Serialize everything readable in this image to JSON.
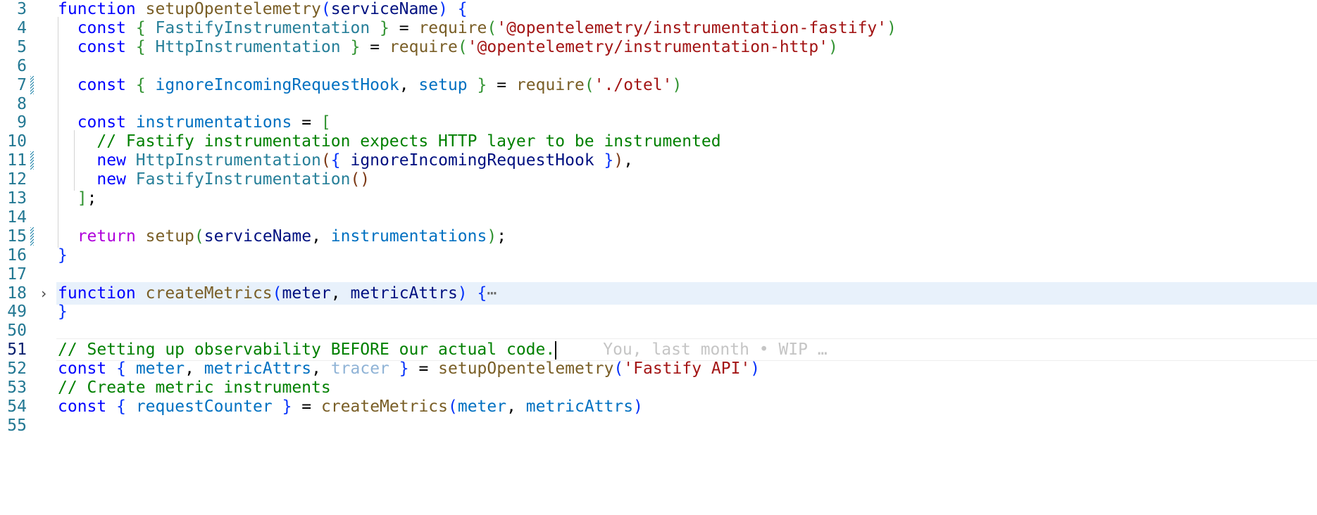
{
  "editor": {
    "lines": [
      {
        "n": "3",
        "code": [
          [
            "k",
            "function"
          ],
          [
            "p",
            " "
          ],
          [
            "f",
            "setupOpentelemetry"
          ],
          [
            "b1",
            "("
          ],
          [
            "v",
            "serviceName"
          ],
          [
            "b1",
            ")"
          ],
          [
            "p",
            " "
          ],
          [
            "b1",
            "{"
          ]
        ]
      },
      {
        "n": "4",
        "code": [
          [
            "p",
            "  "
          ],
          [
            "k",
            "const"
          ],
          [
            "p",
            " "
          ],
          [
            "b2",
            "{"
          ],
          [
            "p",
            " "
          ],
          [
            "c",
            "FastifyInstrumentation"
          ],
          [
            "p",
            " "
          ],
          [
            "b2",
            "}"
          ],
          [
            "p",
            " = "
          ],
          [
            "f",
            "require"
          ],
          [
            "b2",
            "("
          ],
          [
            "s",
            "'@opentelemetry/instrumentation-fastify'"
          ],
          [
            "b2",
            ")"
          ]
        ]
      },
      {
        "n": "5",
        "code": [
          [
            "p",
            "  "
          ],
          [
            "k",
            "const"
          ],
          [
            "p",
            " "
          ],
          [
            "b2",
            "{"
          ],
          [
            "p",
            " "
          ],
          [
            "c",
            "HttpInstrumentation"
          ],
          [
            "p",
            " "
          ],
          [
            "b2",
            "}"
          ],
          [
            "p",
            " = "
          ],
          [
            "f",
            "require"
          ],
          [
            "b2",
            "("
          ],
          [
            "s",
            "'@opentelemetry/instrumentation-http'"
          ],
          [
            "b2",
            ")"
          ]
        ]
      },
      {
        "n": "6",
        "code": []
      },
      {
        "n": "7",
        "mod": true,
        "code": [
          [
            "p",
            "  "
          ],
          [
            "k",
            "const"
          ],
          [
            "p",
            " "
          ],
          [
            "b2",
            "{"
          ],
          [
            "p",
            " "
          ],
          [
            "vb",
            "ignoreIncomingRequestHook"
          ],
          [
            "p",
            ", "
          ],
          [
            "vb",
            "setup"
          ],
          [
            "p",
            " "
          ],
          [
            "b2",
            "}"
          ],
          [
            "p",
            " = "
          ],
          [
            "f",
            "require"
          ],
          [
            "b2",
            "("
          ],
          [
            "s",
            "'./otel'"
          ],
          [
            "b2",
            ")"
          ]
        ]
      },
      {
        "n": "8",
        "code": []
      },
      {
        "n": "9",
        "code": [
          [
            "p",
            "  "
          ],
          [
            "k",
            "const"
          ],
          [
            "p",
            " "
          ],
          [
            "vb",
            "instrumentations"
          ],
          [
            "p",
            " = "
          ],
          [
            "b2",
            "["
          ]
        ]
      },
      {
        "n": "10",
        "code": [
          [
            "p",
            "    "
          ],
          [
            "cm",
            "// Fastify instrumentation expects HTTP layer to be instrumented"
          ]
        ]
      },
      {
        "n": "11",
        "mod": true,
        "code": [
          [
            "p",
            "    "
          ],
          [
            "k",
            "new"
          ],
          [
            "p",
            " "
          ],
          [
            "c",
            "HttpInstrumentation"
          ],
          [
            "b3",
            "("
          ],
          [
            "b1",
            "{"
          ],
          [
            "p",
            " "
          ],
          [
            "v",
            "ignoreIncomingRequestHook"
          ],
          [
            "p",
            " "
          ],
          [
            "b1",
            "}"
          ],
          [
            "b3",
            ")"
          ],
          [
            "p",
            ","
          ]
        ]
      },
      {
        "n": "12",
        "code": [
          [
            "p",
            "    "
          ],
          [
            "k",
            "new"
          ],
          [
            "p",
            " "
          ],
          [
            "c",
            "FastifyInstrumentation"
          ],
          [
            "b3",
            "()"
          ]
        ]
      },
      {
        "n": "13",
        "code": [
          [
            "p",
            "  "
          ],
          [
            "b2",
            "]"
          ],
          [
            "p",
            ";"
          ]
        ]
      },
      {
        "n": "14",
        "code": []
      },
      {
        "n": "15",
        "mod": true,
        "code": [
          [
            "p",
            "  "
          ],
          [
            "kc",
            "return"
          ],
          [
            "p",
            " "
          ],
          [
            "f",
            "setup"
          ],
          [
            "b2",
            "("
          ],
          [
            "v",
            "serviceName"
          ],
          [
            "p",
            ", "
          ],
          [
            "vb",
            "instrumentations"
          ],
          [
            "b2",
            ")"
          ],
          [
            "p",
            ";"
          ]
        ]
      },
      {
        "n": "16",
        "code": [
          [
            "b1",
            "}"
          ]
        ]
      },
      {
        "n": "17",
        "code": []
      },
      {
        "n": "18",
        "folded": true,
        "code": [
          [
            "k",
            "function"
          ],
          [
            "p",
            " "
          ],
          [
            "f",
            "createMetrics"
          ],
          [
            "b1",
            "("
          ],
          [
            "v",
            "meter"
          ],
          [
            "p",
            ", "
          ],
          [
            "v",
            "metricAttrs"
          ],
          [
            "b1",
            ")"
          ],
          [
            "p",
            " "
          ],
          [
            "b1",
            "{"
          ],
          [
            "ell",
            "⋯"
          ]
        ]
      },
      {
        "n": "49",
        "code": [
          [
            "b1",
            "}"
          ]
        ]
      },
      {
        "n": "50",
        "code": []
      },
      {
        "n": "51",
        "current": true,
        "code": [
          [
            "cm",
            "// Setting up observability BEFORE our actual code."
          ]
        ],
        "blame": "You, last month • WIP …"
      },
      {
        "n": "52",
        "code": [
          [
            "k",
            "const"
          ],
          [
            "p",
            " "
          ],
          [
            "b1",
            "{"
          ],
          [
            "p",
            " "
          ],
          [
            "vb",
            "meter"
          ],
          [
            "p",
            ", "
          ],
          [
            "vb",
            "metricAttrs"
          ],
          [
            "p",
            ", "
          ],
          [
            "fade",
            "tracer"
          ],
          [
            "p",
            " "
          ],
          [
            "b1",
            "}"
          ],
          [
            "p",
            " = "
          ],
          [
            "f",
            "setupOpentelemetry"
          ],
          [
            "b1",
            "("
          ],
          [
            "s",
            "'Fastify API'"
          ],
          [
            "b1",
            ")"
          ]
        ]
      },
      {
        "n": "53",
        "code": [
          [
            "cm",
            "// Create metric instruments"
          ]
        ]
      },
      {
        "n": "54",
        "code": [
          [
            "k",
            "const"
          ],
          [
            "p",
            " "
          ],
          [
            "b1",
            "{"
          ],
          [
            "p",
            " "
          ],
          [
            "vb",
            "requestCounter"
          ],
          [
            "p",
            " "
          ],
          [
            "b1",
            "}"
          ],
          [
            "p",
            " = "
          ],
          [
            "f",
            "createMetrics"
          ],
          [
            "b1",
            "("
          ],
          [
            "vb",
            "meter"
          ],
          [
            "p",
            ", "
          ],
          [
            "vb",
            "metricAttrs"
          ],
          [
            "b1",
            ")"
          ]
        ]
      },
      {
        "n": "55",
        "code": []
      }
    ]
  }
}
